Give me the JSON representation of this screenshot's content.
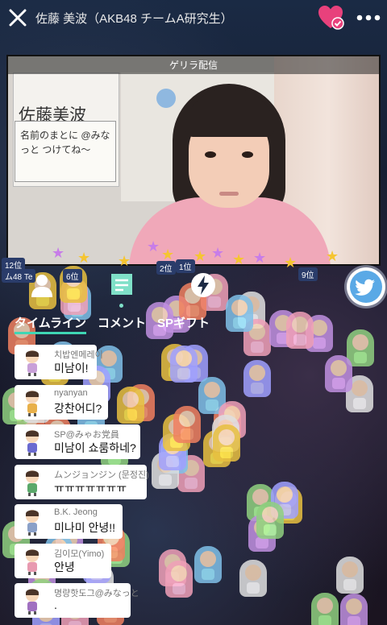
{
  "header": {
    "close_icon": "close-icon",
    "title": "佐藤 美波（AKB48 チームA研究生）",
    "favorite_icon": "heart-check-icon",
    "favorite_color": "#e8417c",
    "more_icon": "more-dots-icon"
  },
  "video": {
    "label": "ゲリラ配信",
    "board_text": "佐藤美波",
    "sign_text": "名前のまとに @みなっと つけてね〜"
  },
  "nav": {
    "profile_icon": "person-icon",
    "comment_icon": "comment-list-icon",
    "gift_icon": "lightning-icon",
    "share_icon": "twitter-icon",
    "accent_color": "#3fd6b4"
  },
  "tabs": [
    {
      "label": "タイムライン",
      "active": true
    },
    {
      "label": "コメント",
      "active": false
    },
    {
      "label": "SPギフト",
      "active": false
    }
  ],
  "comments": [
    {
      "name": "치밥엔메레이",
      "text": "미남이!"
    },
    {
      "name": "nyanyan",
      "text": "강찬어디?"
    },
    {
      "name": "SP@みゃお党員",
      "text": "미남이 쇼룸하네?"
    },
    {
      "name": "ムンジョンジン (문정진)",
      "text": "ㅠㅠㅠㅠㅠㅠㅠ"
    },
    {
      "name": "B.K. Jeong",
      "text": "미나미 안녕!!"
    },
    {
      "name": "김이모(Yimo)",
      "text": "안녕"
    },
    {
      "name": "명량핫도그@みなっと",
      "text": "."
    }
  ],
  "ranks": [
    "12位",
    "6位",
    "2位",
    "1位",
    "9位",
    "ム48 Te"
  ]
}
